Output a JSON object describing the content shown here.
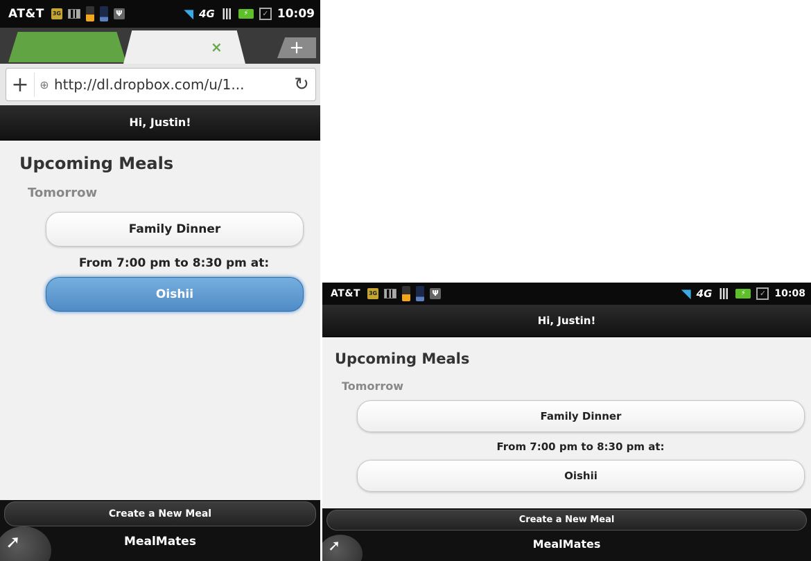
{
  "screen1": {
    "status": {
      "carrier": "AT&T",
      "time": "10:09"
    },
    "browser": {
      "url": "http://dl.dropbox.com/u/1...",
      "close_glyph": "×",
      "new_tab_glyph": "+"
    },
    "header": "Hi, Justin!",
    "title": "Upcoming Meals",
    "day": "Tomorrow",
    "meal_name": "Family Dinner",
    "time_range": "From 7:00 pm to 8:30 pm at:",
    "place": "Oishii",
    "create_label": "Create a New Meal",
    "app_name": "MealMates"
  },
  "screen2": {
    "status": {
      "carrier": "AT&T",
      "time": "10:08"
    },
    "header": "Hi, Justin!",
    "title": "Upcoming Meals",
    "day": "Tomorrow",
    "meal_name": "Family Dinner",
    "time_range": "From 7:00 pm to 8:30 pm at:",
    "place": "Oishii",
    "create_label": "Create a New Meal",
    "app_name": "MealMates"
  },
  "colors": {
    "accent_blue": "#5b9bd5",
    "tab_green": "#60a444",
    "status_bg": "#0b0b0b"
  }
}
